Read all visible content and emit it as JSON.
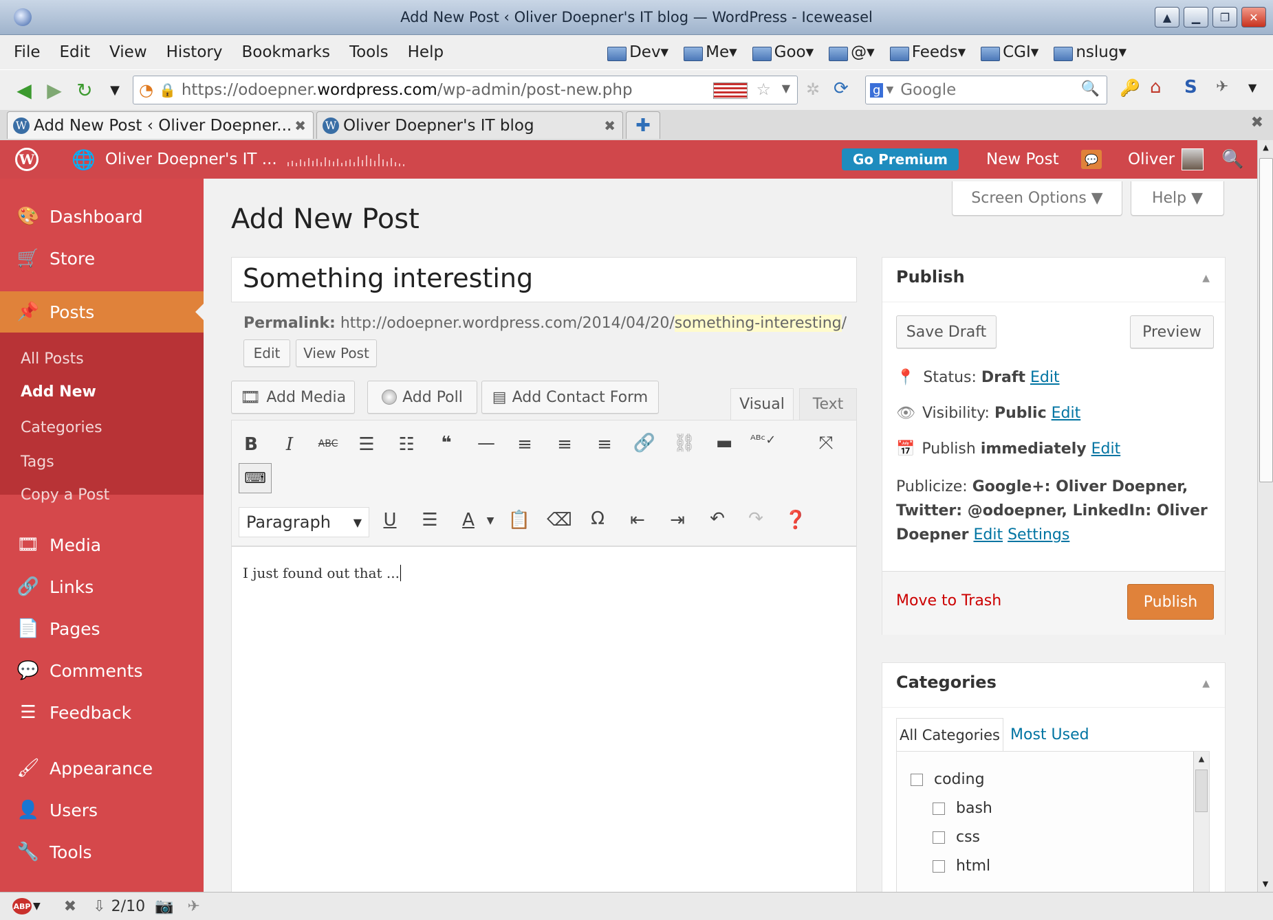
{
  "window": {
    "title": "Add New Post ‹ Oliver Doepner's IT blog — WordPress - Iceweasel"
  },
  "menubar": {
    "items": [
      "File",
      "Edit",
      "View",
      "History",
      "Bookmarks",
      "Tools",
      "Help"
    ]
  },
  "bookmarks": [
    "Dev▾",
    "Me▾",
    "Goo▾",
    "@▾",
    "Feeds▾",
    "CGI▾",
    "nslug▾"
  ],
  "navbar": {
    "url_prefix": "https://odoepner.",
    "url_host": "wordpress.com",
    "url_path": "/wp-admin/post-new.php",
    "search_placeholder": "Google"
  },
  "tabs": [
    {
      "label": "Add New Post ‹ Oliver Doepner...",
      "close": "✖"
    },
    {
      "label": "Oliver Doepner's IT blog",
      "close": "✖"
    }
  ],
  "adminbar": {
    "site_name": "Oliver Doepner's IT ...",
    "go_premium": "Go Premium",
    "new_post": "New Post",
    "user": "Oliver"
  },
  "sidebar": {
    "items": [
      {
        "label": "Dashboard",
        "icon": "🎨"
      },
      {
        "label": "Store",
        "icon": "🛒"
      },
      {
        "label": "Posts",
        "icon": "📌"
      },
      {
        "label": "Media",
        "icon": "🎞"
      },
      {
        "label": "Links",
        "icon": "🔗"
      },
      {
        "label": "Pages",
        "icon": "📄"
      },
      {
        "label": "Comments",
        "icon": "💬"
      },
      {
        "label": "Feedback",
        "icon": "☰"
      },
      {
        "label": "Appearance",
        "icon": "🖌"
      },
      {
        "label": "Users",
        "icon": "👤"
      },
      {
        "label": "Tools",
        "icon": "🔧"
      }
    ],
    "subitems": [
      "All Posts",
      "Add New",
      "Categories",
      "Tags",
      "Copy a Post"
    ]
  },
  "page": {
    "title": "Add New Post",
    "screen_options": "Screen Options ▼",
    "help": "Help ▼"
  },
  "editor": {
    "post_title": "Something interesting",
    "permalink_label": "Permalink:",
    "permalink_base": "http://odoepner.wordpress.com/2014/04/20/",
    "permalink_slug": "something-interesting",
    "permalink_end": "/",
    "edit_btn": "Edit",
    "view_post_btn": "View Post",
    "add_media": "Add Media",
    "add_poll": "Add Poll",
    "add_contact_form": "Add Contact Form",
    "tab_visual": "Visual",
    "tab_text": "Text",
    "format_select": "Paragraph",
    "body_text": "I just found out that ..."
  },
  "publish": {
    "heading": "Publish",
    "save_draft": "Save Draft",
    "preview": "Preview",
    "status_label": "Status:",
    "status_value": "Draft",
    "visibility_label": "Visibility:",
    "visibility_value": "Public",
    "publish_label": "Publish",
    "publish_value": "immediately",
    "edit": "Edit",
    "publicize_label": "Publicize:",
    "publicize_line1": "Google+: Oliver Doepner,",
    "publicize_line2": "Twitter: @odoepner, LinkedIn: Oliver",
    "publicize_line3": "Doepner",
    "settings": "Settings",
    "move_to_trash": "Move to Trash",
    "publish_btn": "Publish"
  },
  "categories": {
    "heading": "Categories",
    "tab_all": "All Categories",
    "tab_most_used": "Most Used",
    "items": [
      "coding",
      "bash",
      "css",
      "html"
    ]
  },
  "statusbar": {
    "count": "2/10"
  },
  "colors": {
    "wp_red": "#d0474b",
    "wp_red_dark": "#b83336",
    "posts_orange": "#e0823a",
    "publish_orange": "#e0823a",
    "link_blue": "#0074a2"
  }
}
